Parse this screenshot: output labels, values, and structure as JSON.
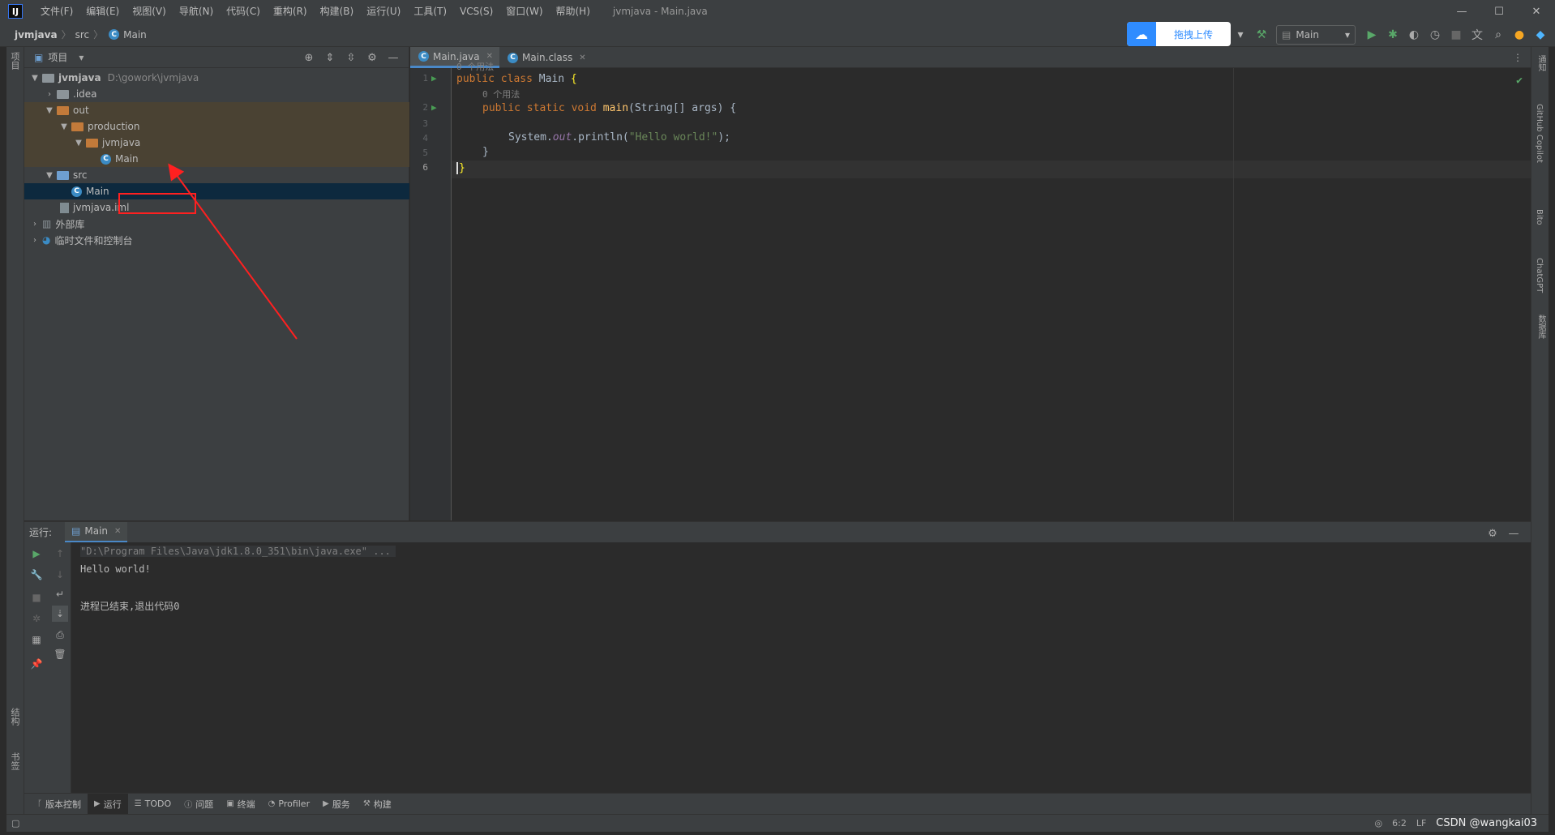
{
  "app": {
    "logo_text": "IJ",
    "window_title": "jvmjava - Main.java",
    "menu": [
      "文件(F)",
      "编辑(E)",
      "视图(V)",
      "导航(N)",
      "代码(C)",
      "重构(R)",
      "构建(B)",
      "运行(U)",
      "工具(T)",
      "VCS(S)",
      "窗口(W)",
      "帮助(H)"
    ]
  },
  "breadcrumb": {
    "project": "jvmjava",
    "folder": "src",
    "file": "Main"
  },
  "toolbar": {
    "upload_label": "拖拽上传",
    "run_config": "Main"
  },
  "left_strip": {
    "top": "项目",
    "mid": "结构",
    "bottom": "书签"
  },
  "right_strip": [
    "通知",
    "GitHub Copilot",
    "Bito",
    "ChatGPT",
    "数据库"
  ],
  "project_panel": {
    "title": "项目",
    "tree": [
      {
        "label": "jvmjava",
        "hint": "D:\\gowork\\jvmjava"
      },
      {
        "label": ".idea"
      },
      {
        "label": "out"
      },
      {
        "label": "production"
      },
      {
        "label": "jvmjava"
      },
      {
        "label": "Main"
      },
      {
        "label": "src"
      },
      {
        "label": "Main"
      },
      {
        "label": "jvmjava.iml"
      },
      {
        "label": "外部库"
      },
      {
        "label": "临时文件和控制台"
      }
    ]
  },
  "editor": {
    "tabs": [
      {
        "label": "Main.java"
      },
      {
        "label": "Main.class"
      }
    ],
    "usage_hint": "0 个用法",
    "line_numbers": [
      "1",
      "2",
      "3",
      "4",
      "5",
      "6"
    ],
    "code": {
      "l1_kw": "public class ",
      "l1_name": "Main ",
      "l1_brace": "{",
      "l2_kw": "public static void ",
      "l2_fn": "main",
      "l2_rest": "(String[] args) {",
      "l4_pre": "System.",
      "l4_fld": "out",
      "l4_mid": ".println(",
      "l4_str": "\"Hello world!\"",
      "l4_end": ");",
      "l5": "}",
      "l6": "}"
    }
  },
  "run_panel": {
    "title": "运行:",
    "tab": "Main",
    "console": [
      "\"D:\\Program Files\\Java\\jdk1.8.0_351\\bin\\java.exe\" ...",
      "Hello world!",
      "",
      "进程已结束,退出代码0"
    ]
  },
  "bottom_tools": [
    "版本控制",
    "运行",
    "TODO",
    "问题",
    "终端",
    "Profiler",
    "服务",
    "构建"
  ],
  "status_bar": {
    "position": "6:2",
    "line_sep": "LF",
    "watermark": "CSDN @wangkai03"
  }
}
